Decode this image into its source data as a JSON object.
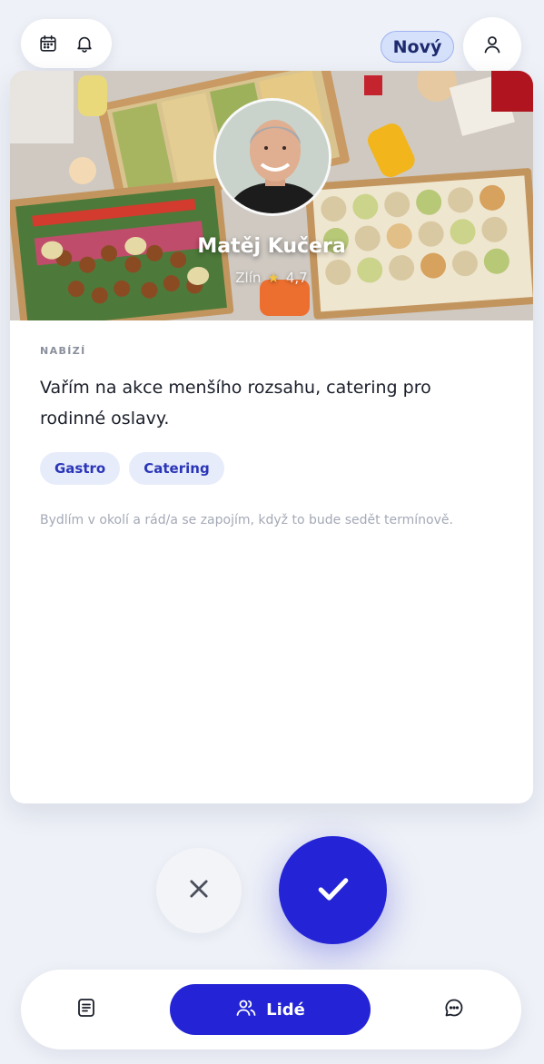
{
  "header": {
    "badge_label": "Nový",
    "icons": [
      "calendar-icon",
      "bell-icon",
      "user-icon"
    ]
  },
  "profile": {
    "name": "Matěj Kučera",
    "location": "Zlín",
    "rating": "4,7",
    "section_label": "NABÍZÍ",
    "description": "Vařím na akce menšího rozsahu, catering pro rodinné oslavy.",
    "tags": [
      "Gastro",
      "Catering"
    ],
    "note": "Bydlím v okolí a rád/a se zapojím, když to bude sedět termínově."
  },
  "actions": {
    "reject_icon": "close-icon",
    "accept_icon": "check-icon"
  },
  "bottom_nav": {
    "items": [
      {
        "icon": "document-icon",
        "label": ""
      },
      {
        "icon": "people-icon",
        "label": "Lidé"
      },
      {
        "icon": "chat-icon",
        "label": ""
      }
    ]
  },
  "colors": {
    "accent": "#2424d6",
    "badge_bg": "#d5e0fb",
    "tag_bg": "#e7ecfb",
    "page_bg": "#eef1f7"
  }
}
